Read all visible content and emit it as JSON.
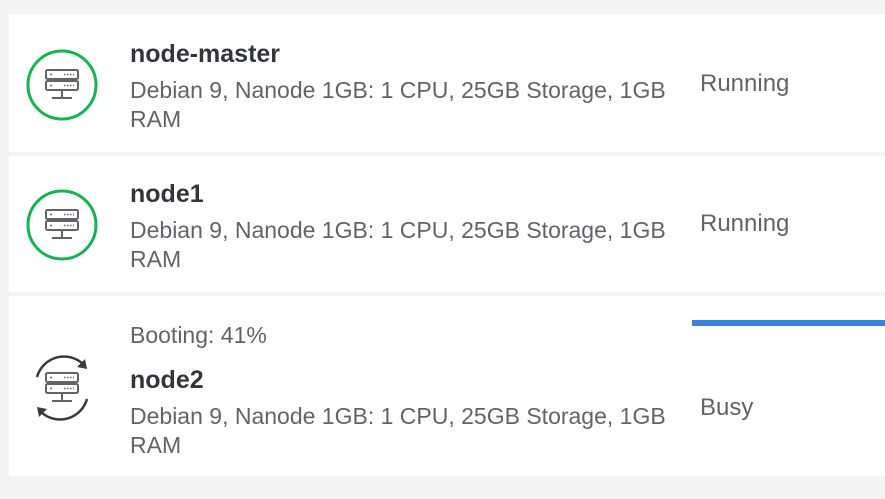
{
  "linodes": [
    {
      "name": "node-master",
      "specs": "Debian 9, Nanode 1GB: 1 CPU, 25GB Storage, 1GB RAM",
      "status": "Running",
      "status_icon": "server-running-icon",
      "status_color": "#17b253"
    },
    {
      "name": "node1",
      "specs": "Debian 9, Nanode 1GB: 1 CPU, 25GB Storage, 1GB RAM",
      "status": "Running",
      "status_icon": "server-running-icon",
      "status_color": "#17b253"
    },
    {
      "name": "node2",
      "specs": "Debian 9, Nanode 1GB: 1 CPU, 25GB Storage, 1GB RAM",
      "status": "Busy",
      "status_icon": "server-busy-icon",
      "status_color": "#3a3a3a",
      "progress_text": "Booting: 41%",
      "progress_percent": 100,
      "progress_color": "#3683dc"
    }
  ]
}
